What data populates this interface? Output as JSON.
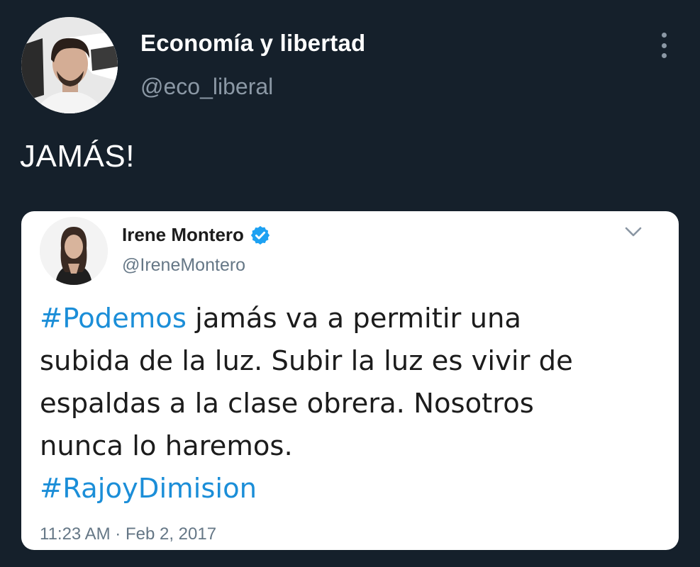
{
  "author": {
    "name": "Economía y libertad",
    "handle": "@eco_liberal"
  },
  "tweet": {
    "text": "JAMÁS!"
  },
  "quote": {
    "name": "Irene Montero",
    "handle": "@IreneMontero",
    "verified": true,
    "body": {
      "hashtag1": "#Podemos",
      "line1_rest": " jamás va a permitir una",
      "line2": "subida de la luz. Subir la luz es vivir de",
      "line3": "espaldas a la clase obrera. Nosotros",
      "line4": "nunca lo haremos.",
      "hashtag2": "#RajoyDimision"
    },
    "timestamp": "11:23 AM · Feb 2, 2017"
  },
  "icons": {
    "more": "more-vertical-icon",
    "chevron": "chevron-down-icon",
    "verified": "verified-badge-icon"
  },
  "colors": {
    "background": "#15202b",
    "hashtag": "#1b8ed8",
    "verified": "#1da1f2",
    "muted_text": "#8b98a5"
  }
}
